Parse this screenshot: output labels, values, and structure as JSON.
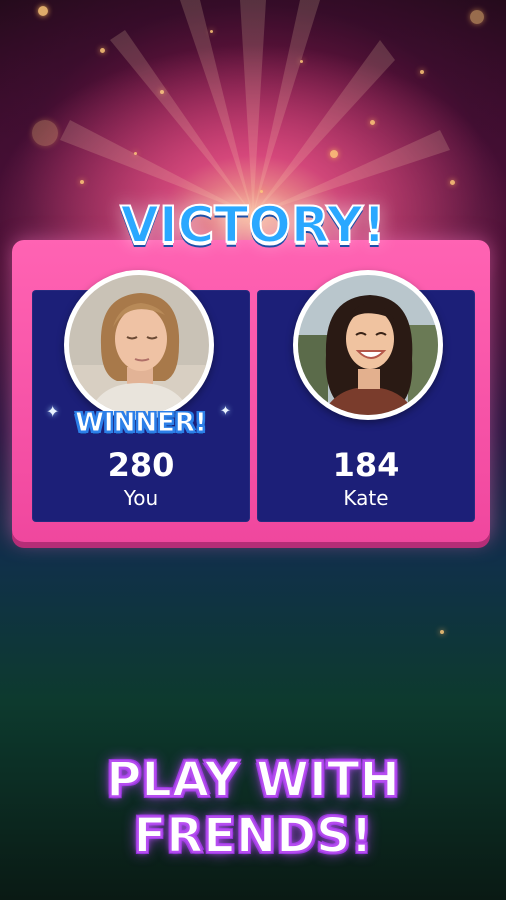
{
  "screen": {
    "title": "VICTORY!",
    "promo_line1": "PLAY WITH",
    "promo_line2": "FRENDS!"
  },
  "players": [
    {
      "name": "You",
      "score": "280",
      "badge": "WINNER!",
      "avatar": "woman-with-short-hair-portrait"
    },
    {
      "name": "Kate",
      "score": "184",
      "badge": "",
      "avatar": "smiling-woman-portrait"
    }
  ],
  "colors": {
    "title": "#2aa8ff",
    "card": "#ff63b3",
    "panel": "#1c1f78",
    "promo_glow": "#b64df0"
  }
}
